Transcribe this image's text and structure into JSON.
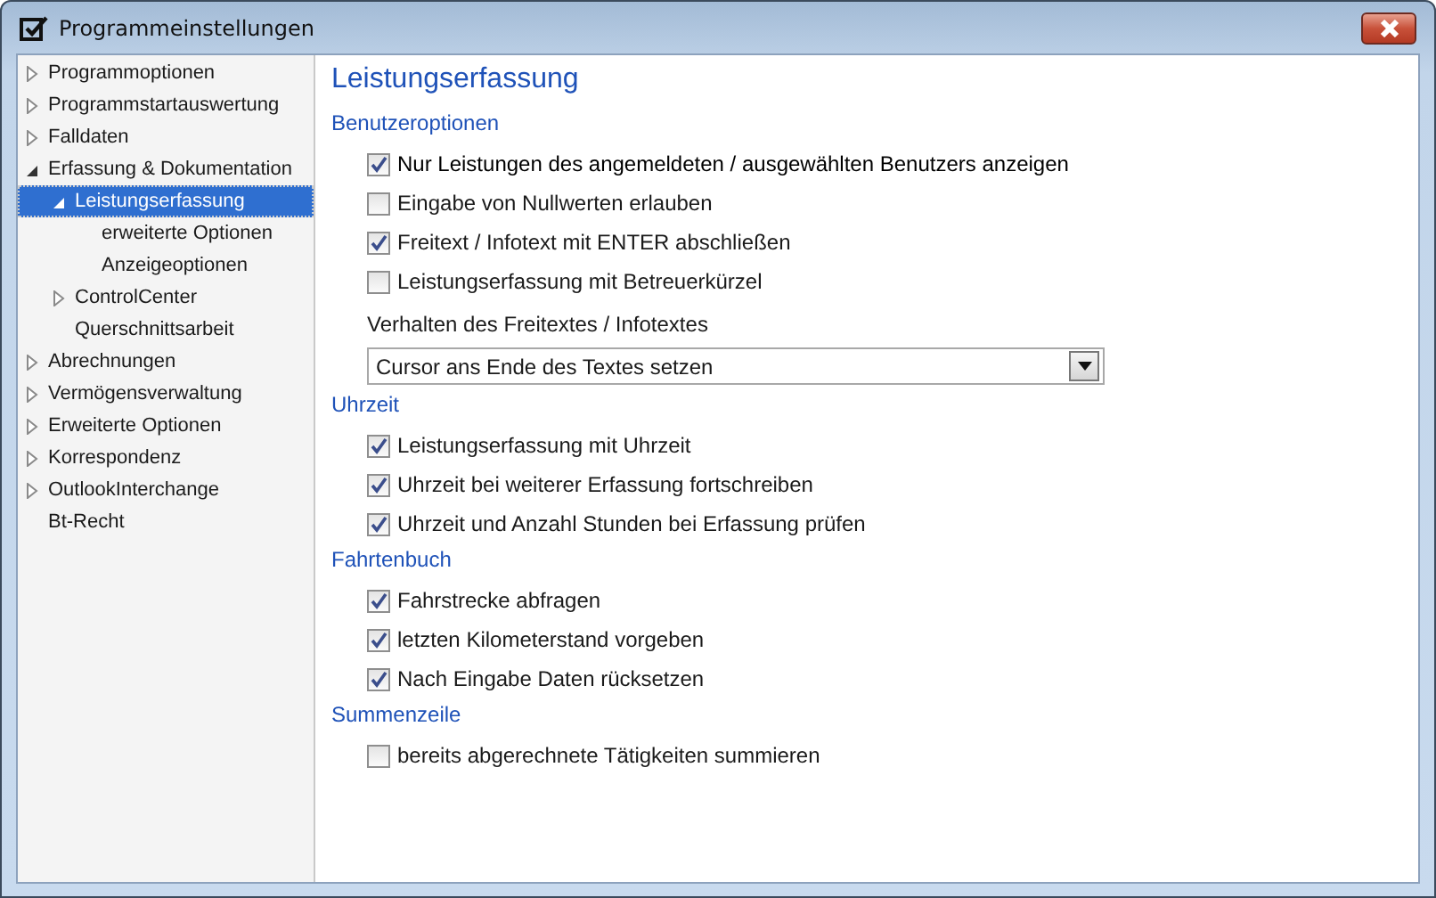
{
  "window": {
    "title": "Programmeinstellungen"
  },
  "sidebar": {
    "items": [
      {
        "label": "Programmoptionen",
        "expanded": false,
        "selected": false
      },
      {
        "label": "Programmstartauswertung",
        "expanded": false,
        "selected": false
      },
      {
        "label": "Falldaten",
        "expanded": false,
        "selected": false
      },
      {
        "label": "Erfassung & Dokumentation",
        "expanded": true,
        "selected": false,
        "children": [
          {
            "label": "Leistungserfassung",
            "expanded": true,
            "selected": true,
            "children": [
              {
                "label": "erweiterte Optionen",
                "selected": false
              },
              {
                "label": "Anzeigeoptionen",
                "selected": false
              }
            ]
          },
          {
            "label": "ControlCenter",
            "expanded": false,
            "selected": false
          },
          {
            "label": "Querschnittsarbeit",
            "selected": false
          }
        ]
      },
      {
        "label": "Abrechnungen",
        "expanded": false,
        "selected": false
      },
      {
        "label": "Vermögensverwaltung",
        "expanded": false,
        "selected": false
      },
      {
        "label": "Erweiterte Optionen",
        "expanded": false,
        "selected": false
      },
      {
        "label": "Korrespondenz",
        "expanded": false,
        "selected": false
      },
      {
        "label": "OutlookInterchange",
        "expanded": false,
        "selected": false
      },
      {
        "label": "Bt-Recht",
        "selected": false
      }
    ]
  },
  "page": {
    "title": "Leistungserfassung",
    "sections": [
      {
        "heading": "Benutzeroptionen",
        "items": [
          {
            "kind": "checkbox",
            "label": "Nur Leistungen des angemeldeten / ausgewählten Benutzers anzeigen",
            "checked": true
          },
          {
            "kind": "checkbox",
            "label": "Eingabe von Nullwerten erlauben",
            "checked": false
          },
          {
            "kind": "checkbox",
            "label": "Freitext / Infotext mit ENTER abschließen",
            "checked": true
          },
          {
            "kind": "checkbox",
            "label": "Leistungserfassung mit Betreuerkürzel",
            "checked": false
          },
          {
            "kind": "dropdown",
            "label": "Verhalten des Freitextes / Infotextes",
            "value": "Cursor ans Ende des Textes setzen"
          }
        ]
      },
      {
        "heading": "Uhrzeit",
        "items": [
          {
            "kind": "checkbox",
            "label": "Leistungserfassung mit Uhrzeit",
            "checked": true
          },
          {
            "kind": "checkbox",
            "label": "Uhrzeit bei weiterer Erfassung fortschreiben",
            "checked": true
          },
          {
            "kind": "checkbox",
            "label": "Uhrzeit und Anzahl Stunden bei Erfassung prüfen",
            "checked": true
          }
        ]
      },
      {
        "heading": "Fahrtenbuch",
        "items": [
          {
            "kind": "checkbox",
            "label": "Fahrstrecke abfragen",
            "checked": true
          },
          {
            "kind": "checkbox",
            "label": "letzten Kilometerstand vorgeben",
            "checked": true
          },
          {
            "kind": "checkbox",
            "label": "Nach Eingabe Daten rücksetzen",
            "checked": true
          }
        ]
      },
      {
        "heading": "Summenzeile",
        "items": [
          {
            "kind": "checkbox",
            "label": "bereits abgerechnete Tätigkeiten summieren",
            "checked": false
          }
        ]
      }
    ]
  }
}
